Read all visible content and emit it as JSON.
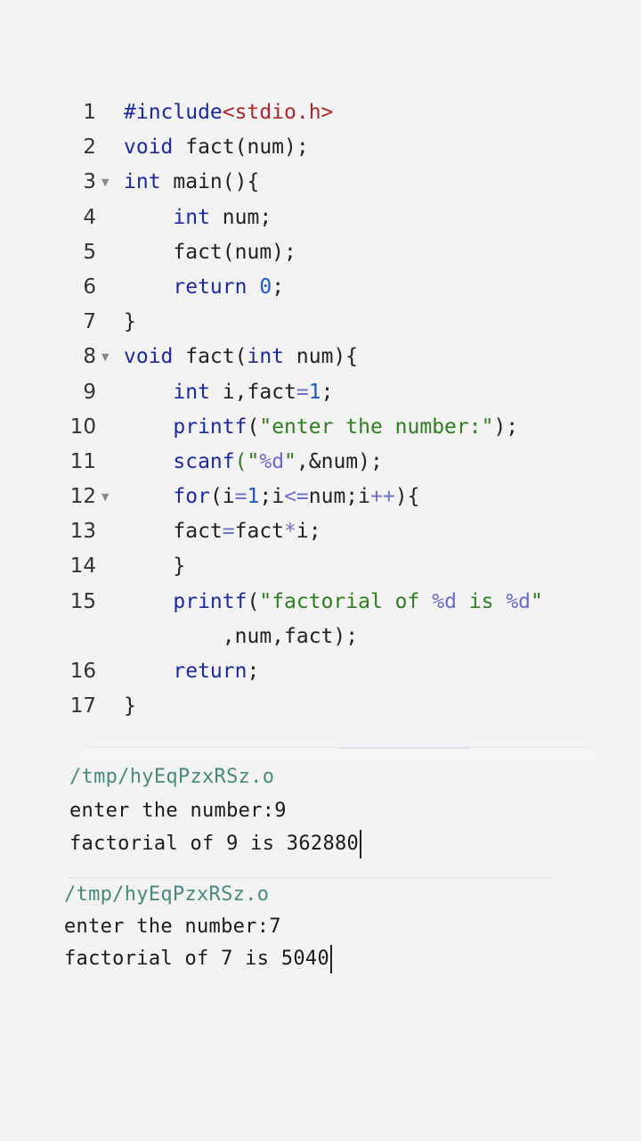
{
  "editor": {
    "lines": [
      {
        "n": "1"
      },
      {
        "n": "2"
      },
      {
        "n": "3"
      },
      {
        "n": "4"
      },
      {
        "n": "5"
      },
      {
        "n": "6"
      },
      {
        "n": "7"
      },
      {
        "n": "8"
      },
      {
        "n": "9"
      },
      {
        "n": "10"
      },
      {
        "n": "11"
      },
      {
        "n": "12"
      },
      {
        "n": "13"
      },
      {
        "n": "14"
      },
      {
        "n": "15"
      },
      {
        "n": ""
      },
      {
        "n": "16"
      },
      {
        "n": "17"
      }
    ],
    "fold_icon": "triangle-down-icon",
    "tokens": {
      "include_directive": "#include",
      "include_header": "<stdio.h>",
      "kw_void": "void",
      "kw_int": "int",
      "kw_return": "return",
      "kw_for": "for",
      "fn_printf": "printf",
      "fn_scanf": "scanf",
      "l2_rest": " fact(num);",
      "l3_rest": " main(){",
      "l4_rest": " num;",
      "l5_text": "fact(num);",
      "l6_zero": "0",
      "l6_semi": ";",
      "brace_close": "}",
      "l8_a": " fact(",
      "l8_b": " num){",
      "l9_a": " i,fact",
      "l9_eq": "=",
      "l9_one": "1",
      "l9_semi": ";",
      "l10_open": "(",
      "l10_str": "\"enter the number:\"",
      "l10_close": ");",
      "l11_open": "(\"",
      "l11_fmt": "%d",
      "l11_q": "\"",
      "l11_rest": ",&num);",
      "l12_a": "(i",
      "l12_eq": "=",
      "l12_one": "1",
      "l12_b": ";i",
      "l12_le": "<=",
      "l12_c": "num;i",
      "l12_pp": "++",
      "l12_d": "){",
      "l13_a": "fact",
      "l13_eq": "=",
      "l13_b": "fact",
      "l13_mul": "*",
      "l13_c": "i;",
      "l15_open": "(",
      "l15_s1": "\"factorial of ",
      "l15_fmt1": "%d",
      "l15_s2": " is ",
      "l15_fmt2": "%d",
      "l15_s3": "\"",
      "l15_wrap": ",num,fact);",
      "l16_semi": ";"
    }
  },
  "terminal": [
    {
      "path": "/tmp/hyEqPzxRSz.o",
      "line1": "enter the number:9",
      "line2": "factorial of 9 is 362880"
    },
    {
      "path": "/tmp/hyEqPzxRSz.o",
      "line1": "enter the number:7",
      "line2": "factorial of 7 is 5040"
    }
  ],
  "colors": {
    "background": "#f3f3f3",
    "keyword": "#1c2aa0",
    "string": "#2e7d1e",
    "include": "#b0262b",
    "number": "#1a58c7",
    "path": "#4a8a7c"
  }
}
